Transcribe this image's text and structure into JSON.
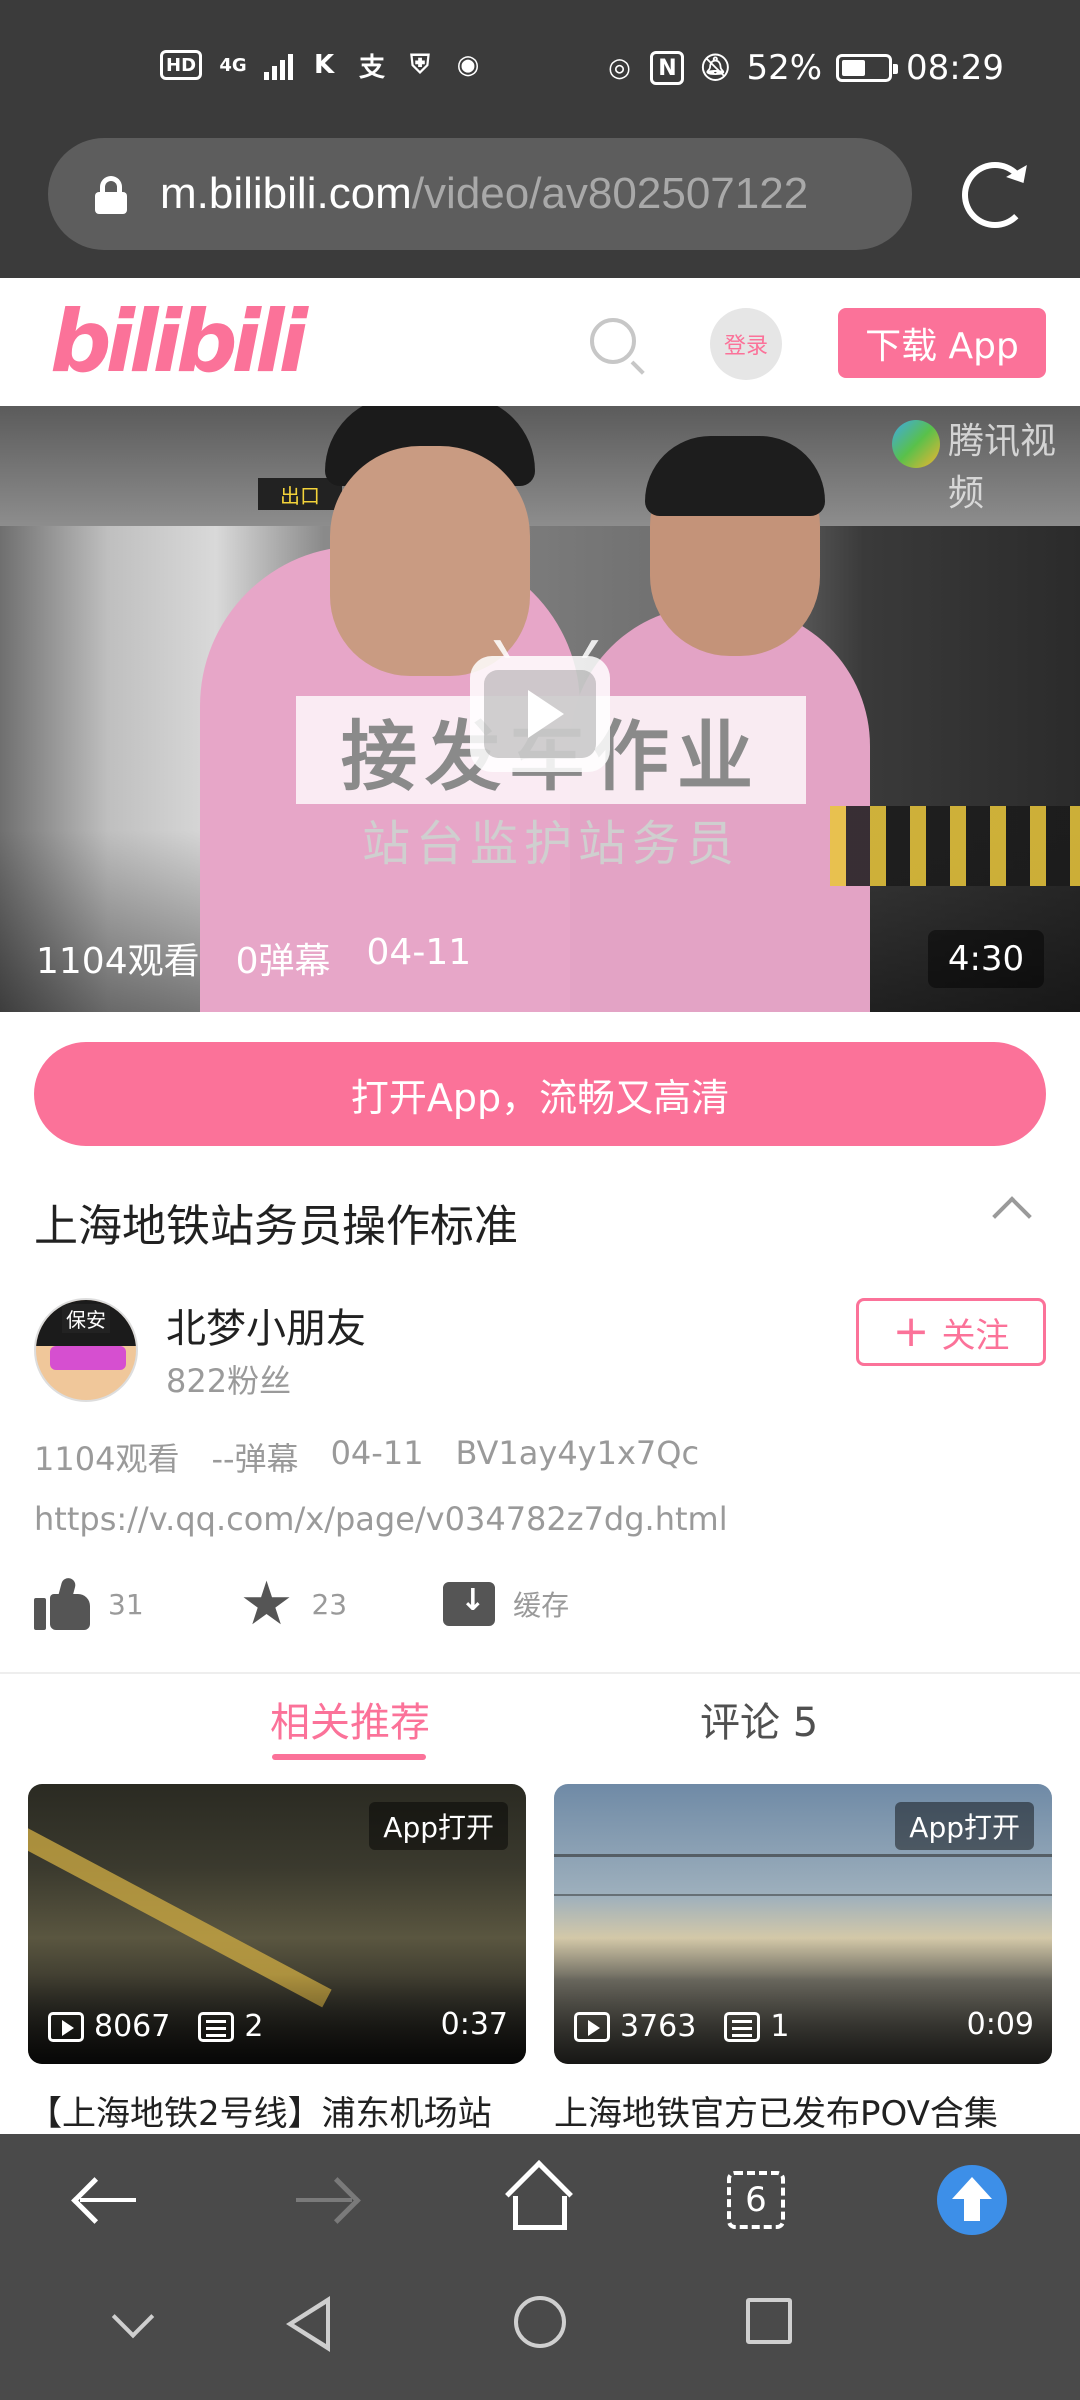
{
  "status_bar": {
    "left_icons": [
      "HD",
      "4G",
      "signal-icon",
      "k-icon",
      "alipay-icon",
      "shield-icon",
      "wifi-hotspot-icon"
    ],
    "hd_label": "HD",
    "net_label": "4G",
    "k_label": "K",
    "pay_label": "支",
    "battery_percent": "52%",
    "battery_level": 0.52,
    "time": "08:29"
  },
  "browser": {
    "url_host": "m.bilibili.com",
    "url_path": "/video/av802507122",
    "colors": {
      "chrome": "#3b3b3b",
      "urlbar": "#5d5d5d"
    }
  },
  "site": {
    "logo_text": "bilibili",
    "login_label": "登录",
    "download_label": "下载 App",
    "accent": "#fb7299"
  },
  "player": {
    "watermark": "腾讯视频",
    "exit_sign": "出口",
    "subtitle_main": "接发车作业",
    "subtitle_sub": "站台监护站务员",
    "views": "1104观看",
    "danmaku": "0弹幕",
    "date": "04-11",
    "duration": "4:30"
  },
  "open_app_label": "打开App，流畅又高清",
  "video": {
    "title": "上海地铁站务员操作标准",
    "uploader": {
      "name": "北梦小朋友",
      "fans": "822粉丝",
      "avatar_cap_text": "保安",
      "follow_label": "关注",
      "follow_prefix": "+"
    },
    "meta": {
      "views": "1104观看",
      "danmaku": "--弹幕",
      "date": "04-11",
      "bvid": "BV1ay4y1x7Qc"
    },
    "source_url": "https://v.qq.com/x/page/v034782z7dg.html",
    "actions": {
      "likes": "31",
      "favorites": "23",
      "cache_label": "缓存"
    }
  },
  "tabs": {
    "recommend": "相关推荐",
    "comments": "评论 5"
  },
  "recommendations": [
    {
      "tag": "App打开",
      "plays": "8067",
      "danmaku": "2",
      "duration": "0:37",
      "title": "【上海地铁2号线】浦东机场站"
    },
    {
      "tag": "App打开",
      "plays": "3763",
      "danmaku": "1",
      "duration": "0:09",
      "title": "上海地铁官方已发布POV合集"
    }
  ],
  "browser_toolbar": {
    "tabs_count": "6",
    "icons": [
      "back-arrow-icon",
      "forward-arrow-icon",
      "home-icon",
      "tabs-icon",
      "scroll-top-icon"
    ]
  },
  "system_nav": {
    "icons": [
      "collapse-chevron-icon",
      "back-triangle-icon",
      "home-circle-icon",
      "recents-square-icon"
    ]
  }
}
